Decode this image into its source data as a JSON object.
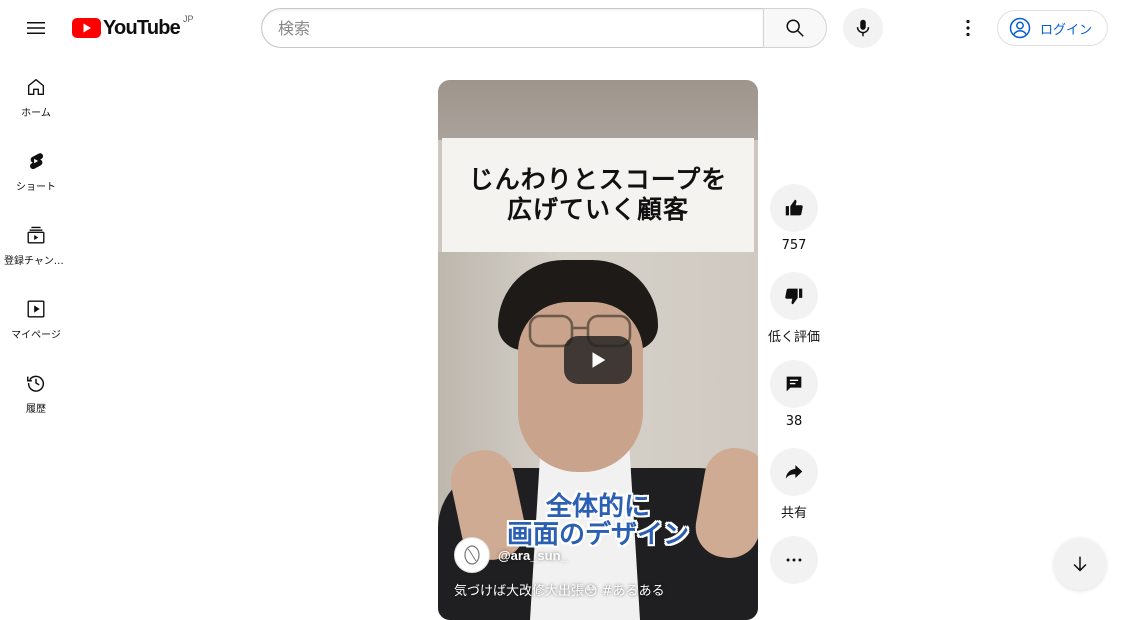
{
  "header": {
    "logo_text": "YouTube",
    "region": "JP",
    "search_placeholder": "検索",
    "login_label": "ログイン"
  },
  "sidebar": {
    "items": [
      {
        "label": "ホーム",
        "icon": "home-icon"
      },
      {
        "label": "ショート",
        "icon": "shorts-icon"
      },
      {
        "label": "登録チャンネル",
        "icon": "subscriptions-icon"
      },
      {
        "label": "マイページ",
        "icon": "library-icon"
      },
      {
        "label": "履歴",
        "icon": "history-icon"
      }
    ]
  },
  "video": {
    "caption_line1": "じんわりとスコープを",
    "caption_line2": "広げていく顧客",
    "subtitle_line1": "全体的に",
    "subtitle_line2": "画面のデザイン",
    "channel": "@ara_sun_",
    "title": "気づけば大改修大出張😳 #あるある"
  },
  "actions": {
    "like_count": "757",
    "dislike_label": "低く評価",
    "comment_count": "38",
    "share_label": "共有"
  },
  "colors": {
    "brand_red": "#ff0000",
    "link_blue": "#065fd4",
    "subtitle_blue": "#2b5fb3"
  }
}
